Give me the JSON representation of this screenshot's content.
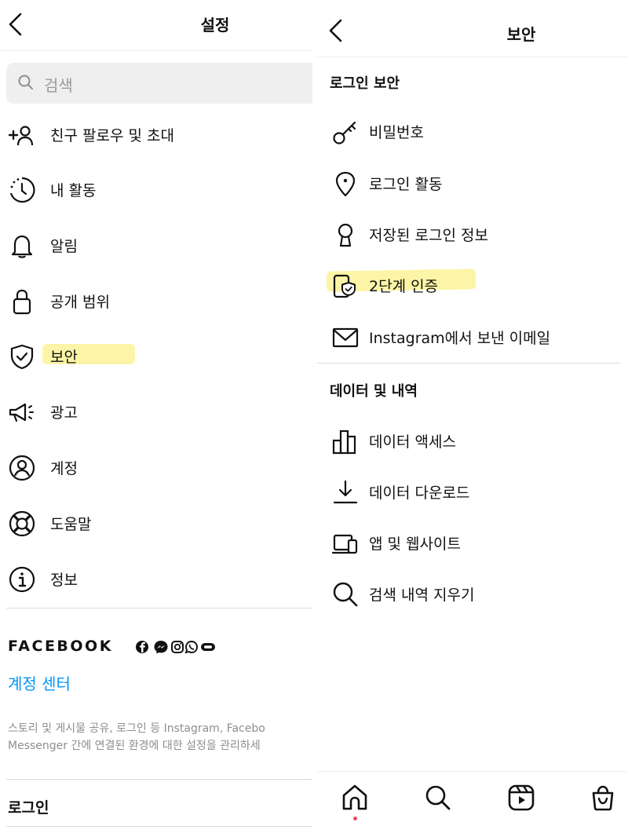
{
  "settings": {
    "title": "설정",
    "search": {
      "placeholder": "검색"
    },
    "items": [
      {
        "label": "친구 팔로우 및 초대",
        "icon": "add-person-icon"
      },
      {
        "label": "내 활동",
        "icon": "activity-clock-icon"
      },
      {
        "label": "알림",
        "icon": "bell-icon"
      },
      {
        "label": "공개 범위",
        "icon": "lock-icon"
      },
      {
        "label": "보안",
        "icon": "shield-check-icon"
      },
      {
        "label": "광고",
        "icon": "megaphone-icon"
      },
      {
        "label": "계정",
        "icon": "user-circle-icon"
      },
      {
        "label": "도움말",
        "icon": "lifebuoy-icon"
      },
      {
        "label": "정보",
        "icon": "info-icon"
      }
    ],
    "facebook": {
      "brand": "FACEBOOK",
      "app_icons": [
        "facebook-icon",
        "messenger-icon",
        "instagram-icon",
        "whatsapp-icon",
        "portal-icon"
      ]
    },
    "account_center": "계정 센터",
    "description_line1": "스토리 및 게시물 공유, 로그인 등 Instagram, Facebo",
    "description_line2": "Messenger 간에 연결된 환경에 대한 설정을 관리하세",
    "login_section": "로그인"
  },
  "security": {
    "title": "보안",
    "login_security": {
      "heading": "로그인 보안",
      "items": [
        {
          "label": "비밀번호",
          "icon": "key-icon"
        },
        {
          "label": "로그인 활동",
          "icon": "location-pin-icon"
        },
        {
          "label": "저장된 로그인 정보",
          "icon": "keyhole-icon"
        },
        {
          "label": "2단계 인증",
          "icon": "phone-shield-icon"
        },
        {
          "label": "Instagram에서 보낸 이메일",
          "icon": "mail-icon"
        }
      ]
    },
    "data_history": {
      "heading": "데이터 및 내역",
      "items": [
        {
          "label": "데이터 액세스",
          "icon": "bar-chart-icon"
        },
        {
          "label": "데이터 다운로드",
          "icon": "download-icon"
        },
        {
          "label": "앱 및 웹사이트",
          "icon": "devices-icon"
        },
        {
          "label": "검색 내역 지우기",
          "icon": "search-icon"
        }
      ]
    }
  },
  "tabbar": [
    "home-icon",
    "search-icon",
    "reels-icon",
    "shop-icon"
  ],
  "colors": {
    "link": "#0095f6",
    "highlight": "#fbf28a",
    "notification_dot": "#ed4956"
  }
}
